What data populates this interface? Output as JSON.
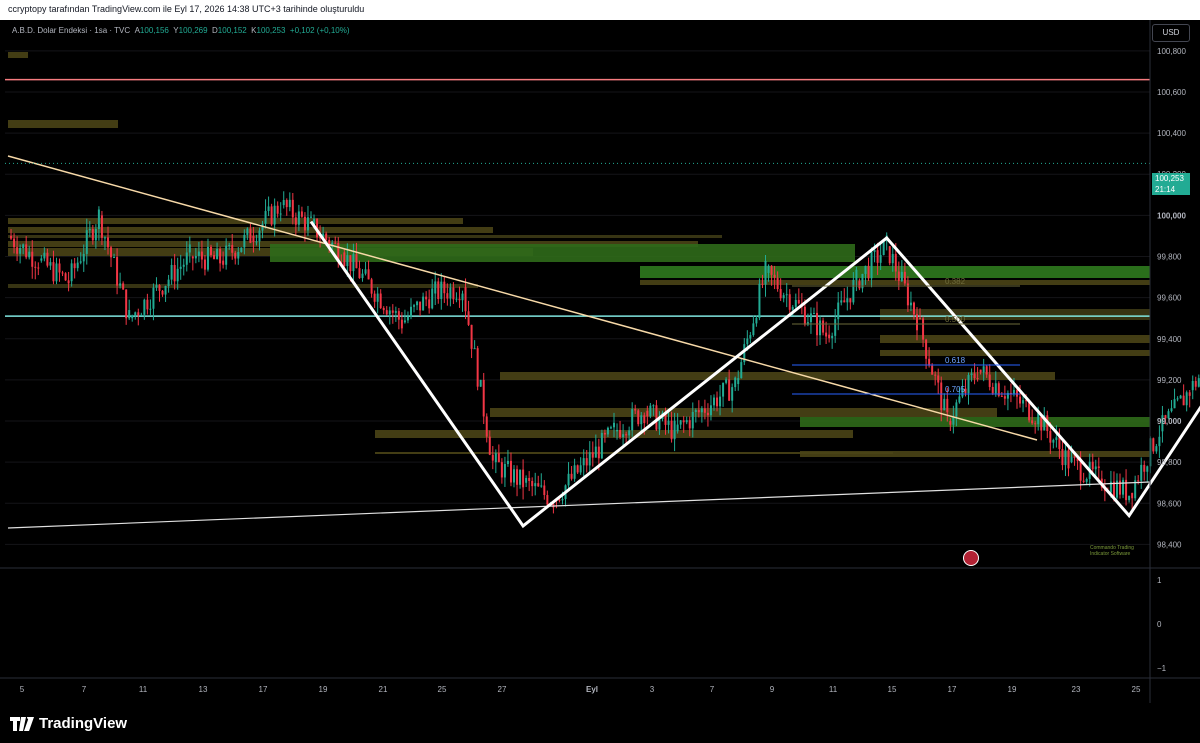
{
  "header": {
    "caption": "ccryptopy tarafından TradingView.com ile Eyl 17, 2026 14:38 UTC+3 tarihinde oluşturuldu"
  },
  "symbol": {
    "name": "A.B.D. Dolar Endeksi",
    "interval": "1sa",
    "source": "TVC",
    "open_label": "A",
    "open": "100,156",
    "high_label": "Y",
    "high": "100,269",
    "low_label": "D",
    "low": "100,152",
    "close_label": "K",
    "close": "100,253",
    "change": "+0,102 (+0,10%)"
  },
  "currency_button": "USD",
  "price_tag": {
    "price": "100,253",
    "countdown": "21:14"
  },
  "watermark": {
    "line1": "Commando Trading",
    "line2": "Indicator Software"
  },
  "brand": "TradingView",
  "colors": {
    "up": "#22ab94",
    "down": "#f23645",
    "background": "#000000",
    "accent_red_line": "#f77c80",
    "cyan_line": "#80e6e0"
  },
  "chart_data": {
    "type": "candlestick",
    "ylim": [
      98.3,
      100.95
    ],
    "y_ticks": [
      "100,800",
      "100,600",
      "100,400",
      "100,200",
      "100,000",
      "99,800",
      "99,600",
      "99,400",
      "99,200",
      "99,000",
      "98,800",
      "98,600",
      "98,400"
    ],
    "x_ticks": [
      "5",
      "7",
      "11",
      "13",
      "17",
      "19",
      "21",
      "25",
      "27",
      "Eyl",
      "3",
      "7",
      "9",
      "11",
      "15",
      "17",
      "19",
      "23",
      "25"
    ],
    "indicator_ticks": [
      "1",
      "0",
      "−1"
    ],
    "fib_labels": [
      "0.382",
      "0.500",
      "0.618",
      "0.705"
    ],
    "horizontal_levels": {
      "red": 100.66,
      "cyan": 99.51
    },
    "zigzag": [
      {
        "x": "Ağu 14",
        "y": 99.97
      },
      {
        "x": "Ağu 21",
        "y": 98.49
      },
      {
        "x": "Eyl 2",
        "y": 99.89
      },
      {
        "x": "Eyl 10",
        "y": 98.54
      },
      {
        "x": "Eyl 16",
        "y": 99.88
      }
    ],
    "price_path": [
      {
        "t": "Ağu 4",
        "p": 99.9
      },
      {
        "t": "Ağu 5",
        "p": 99.78
      },
      {
        "t": "Ağu 6",
        "p": 99.68
      },
      {
        "t": "Ağu 7",
        "p": 100.0
      },
      {
        "t": "Ağu 8",
        "p": 99.5
      },
      {
        "t": "Ağu 10",
        "p": 99.8
      },
      {
        "t": "Ağu 11",
        "p": 99.78
      },
      {
        "t": "Ağu 12",
        "p": 99.9
      },
      {
        "t": "Ağu 13",
        "p": 100.05
      },
      {
        "t": "Ağu 14",
        "p": 99.95
      },
      {
        "t": "Ağu 15",
        "p": 99.82
      },
      {
        "t": "Ağu 17",
        "p": 99.48
      },
      {
        "t": "Ağu 18",
        "p": 99.62
      },
      {
        "t": "Ağu 19",
        "p": 99.65
      },
      {
        "t": "Ağu 20",
        "p": 98.8
      },
      {
        "t": "Ağu 21",
        "p": 98.7
      },
      {
        "t": "Ağu 22",
        "p": 98.62
      },
      {
        "t": "Ağu 24",
        "p": 98.95
      },
      {
        "t": "Ağu 25",
        "p": 99.05
      },
      {
        "t": "Ağu 26",
        "p": 98.95
      },
      {
        "t": "Ağu 28",
        "p": 99.18
      },
      {
        "t": "Ağu 29",
        "p": 99.72
      },
      {
        "t": "Ağu 31",
        "p": 99.42
      },
      {
        "t": "Eyl 1",
        "p": 99.68
      },
      {
        "t": "Eyl 2",
        "p": 99.85
      },
      {
        "t": "Eyl 3",
        "p": 99.5
      },
      {
        "t": "Eyl 4",
        "p": 99.0
      },
      {
        "t": "Eyl 5",
        "p": 99.25
      },
      {
        "t": "Eyl 7",
        "p": 99.02
      },
      {
        "t": "Eyl 8",
        "p": 98.8
      },
      {
        "t": "Eyl 9",
        "p": 98.72
      },
      {
        "t": "Eyl 10",
        "p": 98.65
      },
      {
        "t": "Eyl 11",
        "p": 98.95
      },
      {
        "t": "Eyl 12",
        "p": 99.15
      },
      {
        "t": "Eyl 14",
        "p": 99.55
      },
      {
        "t": "Eyl 15",
        "p": 99.62
      },
      {
        "t": "Eyl 16",
        "p": 99.67
      },
      {
        "t": "Eyl 17",
        "p": 100.25
      }
    ]
  }
}
